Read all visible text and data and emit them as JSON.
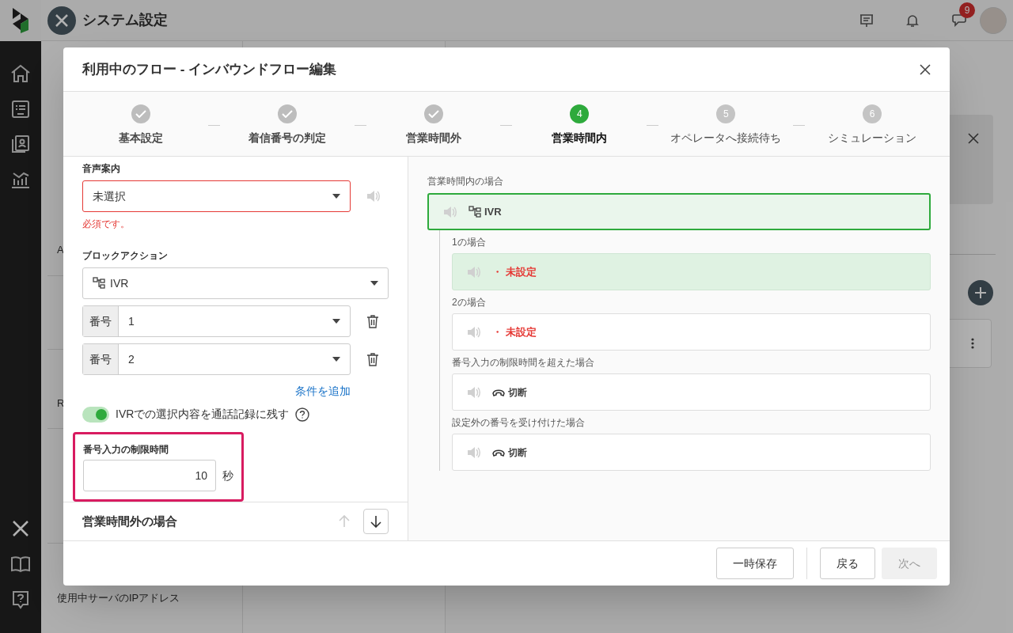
{
  "header": {
    "title": "システム設定",
    "chat_badge": "9"
  },
  "settings_menu": [
    {
      "kind": "item",
      "label": "A",
      "selected": false
    },
    {
      "kind": "item",
      "label": "R",
      "selected": false
    },
    {
      "kind": "item",
      "label": "使用中サーバのIPアドレス",
      "selected": false
    }
  ],
  "dialog": {
    "title": "利用中のフロー - インバウンドフロー編集",
    "steps": [
      {
        "label": "基本設定",
        "completed": true,
        "selected": false
      },
      {
        "label": "着信番号の判定",
        "completed": true,
        "selected": false
      },
      {
        "label": "営業時間外",
        "completed": true,
        "selected": false
      },
      {
        "label": "営業時間内",
        "number": "4",
        "completed": false,
        "selected": true
      },
      {
        "label": "オペレータへ接続待ち",
        "number": "5",
        "completed": false,
        "selected": false
      },
      {
        "label": "シミュレーション",
        "number": "6",
        "completed": false,
        "selected": false
      }
    ],
    "form": {
      "voice_guide": {
        "label": "音声案内",
        "value": "未選択",
        "error": "必須です。"
      },
      "block_action": {
        "label": "ブロックアクション",
        "value": "IVR"
      },
      "conditions": [
        {
          "addon": "番号",
          "value": "1"
        },
        {
          "addon": "番号",
          "value": "2"
        }
      ],
      "add_condition": "条件を追加",
      "record_toggle": {
        "label": "IVRでの選択内容を通話記録に残す",
        "on": true
      },
      "timeout": {
        "label": "番号入力の制限時間",
        "value": "10",
        "unit": "秒",
        "highlighted": true
      },
      "next_section": {
        "title": "営業時間外の場合",
        "up_disabled": true
      }
    },
    "flow": {
      "label": "営業時間内の場合",
      "root": {
        "label": "IVR",
        "selected": true
      },
      "branches": [
        {
          "label": "1の場合",
          "kind": "unset",
          "marker": "・",
          "text": "未設定",
          "highlighted": true
        },
        {
          "label": "2の場合",
          "kind": "unset",
          "marker": "・",
          "text": "未設定",
          "highlighted": false
        },
        {
          "label": "番号入力の制限時間を超えた場合",
          "kind": "hangup",
          "text": "切断",
          "highlighted": false
        },
        {
          "label": "設定外の番号を受け付けた場合",
          "kind": "hangup",
          "text": "切断",
          "highlighted": false
        }
      ]
    },
    "footer": {
      "buttons": [
        {
          "label": "一時保存",
          "disabled": false
        },
        {
          "label": "戻る",
          "disabled": false
        },
        {
          "label": "次へ",
          "disabled": true
        }
      ]
    }
  }
}
